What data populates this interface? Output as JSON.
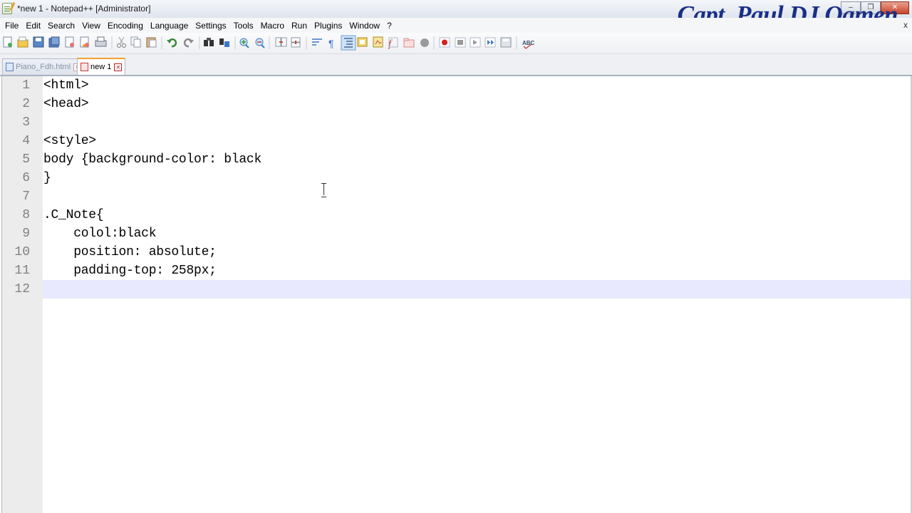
{
  "window": {
    "title": "*new 1 - Notepad++ [Administrator]",
    "brand_watermark": "Capt. Paul DJ Oamen",
    "menu_close": "x"
  },
  "menu": {
    "items": [
      "File",
      "Edit",
      "Search",
      "View",
      "Encoding",
      "Language",
      "Settings",
      "Tools",
      "Macro",
      "Run",
      "Plugins",
      "Window",
      "?"
    ]
  },
  "toolbar": {
    "icons": [
      "new-file-icon",
      "open-file-icon",
      "save-icon",
      "save-all-icon",
      "close-icon",
      "close-all-icon",
      "print-icon",
      "cut-icon",
      "copy-icon",
      "paste-icon",
      "undo-icon",
      "redo-icon",
      "find-icon",
      "replace-icon",
      "zoom-in-icon",
      "zoom-out-icon",
      "sync-vertical-icon",
      "sync-horizontal-icon",
      "word-wrap-icon",
      "show-all-characters-icon",
      "indent-guide-icon",
      "user-language-icon",
      "doc-map-icon",
      "function-list-icon",
      "folder-workspace-icon",
      "monitoring-icon",
      "record-macro-icon",
      "stop-record-icon",
      "playback-macro-icon",
      "run-macro-multiple-icon",
      "save-macro-icon",
      "spell-check-icon"
    ]
  },
  "tabs": [
    {
      "label": "Piano_Fdh.html",
      "active": false
    },
    {
      "label": "new 1",
      "active": true
    }
  ],
  "editor": {
    "current_line": 12,
    "lines": [
      {
        "n": "1",
        "text": "<html>"
      },
      {
        "n": "2",
        "text": "<head>"
      },
      {
        "n": "3",
        "text": ""
      },
      {
        "n": "4",
        "text": "<style>"
      },
      {
        "n": "5",
        "text": "body {background-color: black"
      },
      {
        "n": "6",
        "text": "}"
      },
      {
        "n": "7",
        "text": ""
      },
      {
        "n": "8",
        "text": ".C_Note{"
      },
      {
        "n": "9",
        "text": "    colol:black"
      },
      {
        "n": "10",
        "text": "    position: absolute;"
      },
      {
        "n": "11",
        "text": "    padding-top: 258px;"
      },
      {
        "n": "12",
        "text": ""
      }
    ]
  },
  "colors": {
    "brand": "#1a2f86",
    "active_tab_accent": "#f0a030",
    "current_line_highlight": "#e8e8ff",
    "line_number": "#808080"
  }
}
